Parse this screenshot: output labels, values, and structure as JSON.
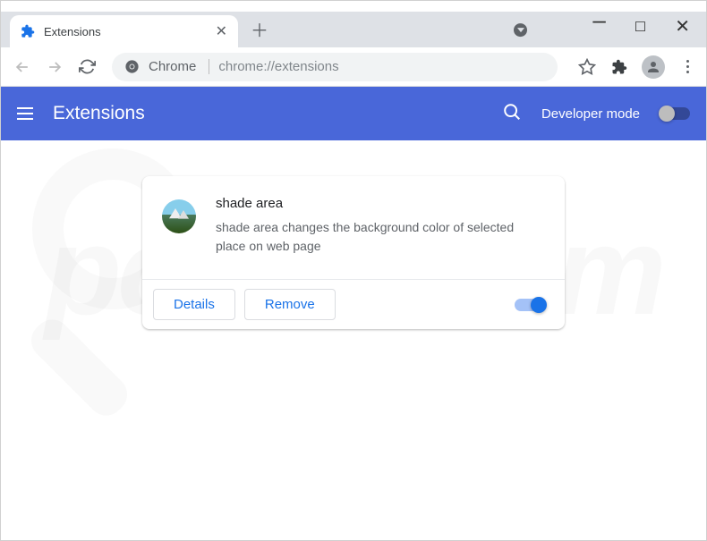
{
  "browser": {
    "tab_title": "Extensions",
    "omnibox_prefix": "Chrome",
    "omnibox_url": "chrome://extensions"
  },
  "header": {
    "title": "Extensions",
    "dev_mode_label": "Developer mode"
  },
  "extension": {
    "name": "shade area",
    "description": "shade area changes the background color of selected place on web page",
    "details_btn": "Details",
    "remove_btn": "Remove"
  },
  "watermark": "pcrisk.com"
}
